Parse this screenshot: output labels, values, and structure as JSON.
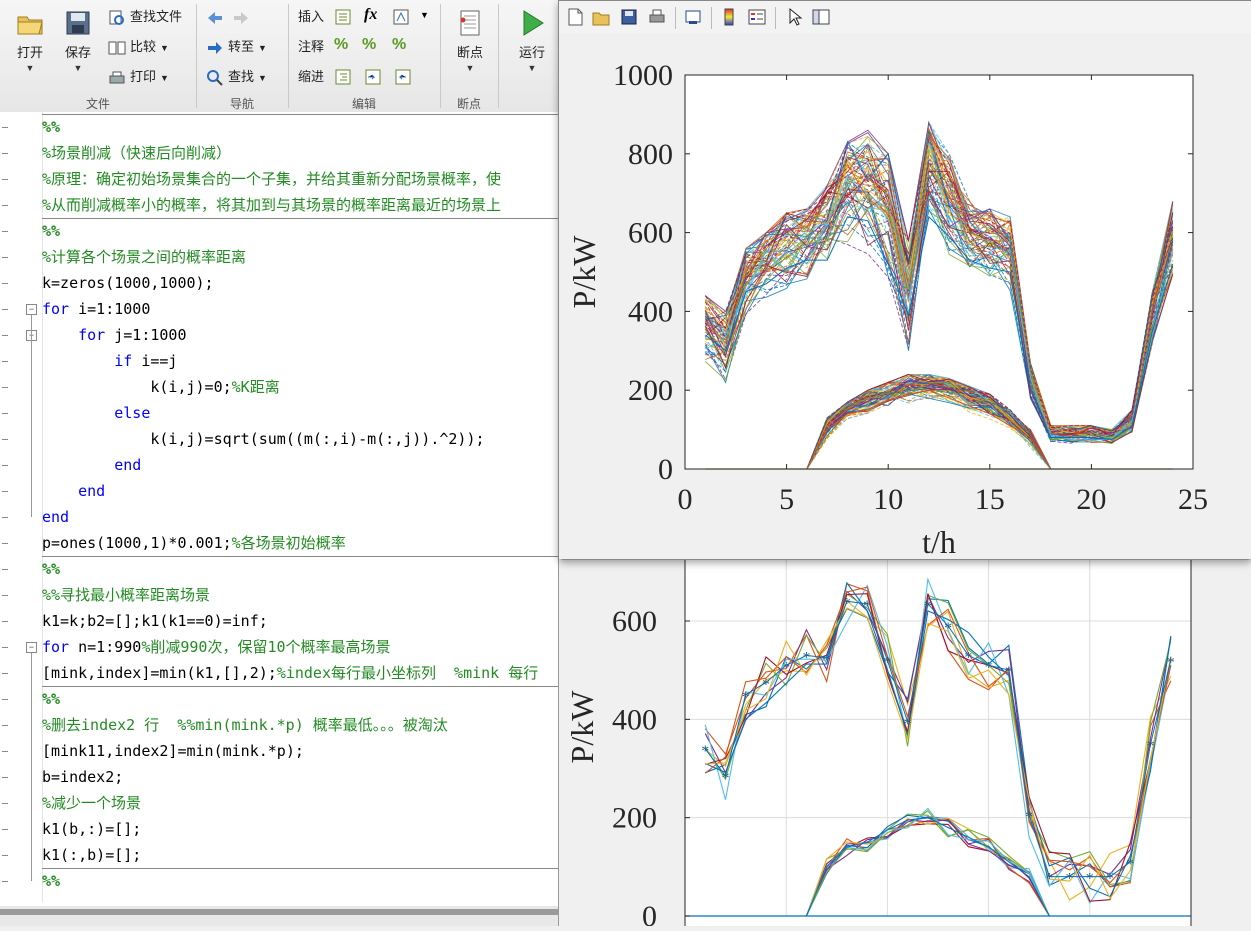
{
  "toolstrip": {
    "file": {
      "open": "打开",
      "save": "保存",
      "find_files": "查找文件",
      "compare": "比较",
      "print": "打印",
      "section": "文件"
    },
    "navigate": {
      "goto": "转至",
      "find": "查找",
      "section": "导航"
    },
    "edit": {
      "insert": "插入",
      "comment": "注释",
      "indent": "缩进",
      "fx": "fx",
      "section": "编辑"
    },
    "breakpoints": {
      "label": "断点",
      "section": "断点"
    },
    "run": {
      "label": "运行"
    }
  },
  "code_lines": [
    {
      "type": "cell",
      "text": "%%"
    },
    {
      "type": "comment",
      "text": "%场景削减（快速后向削减）"
    },
    {
      "type": "comment",
      "text": "%原理：确定初始场景集合的一个子集，并给其重新分配场景概率，使"
    },
    {
      "type": "comment",
      "text": "%从而削减概率小的概率，将其加到与其场景的概率距离最近的场景上"
    },
    {
      "type": "cell",
      "text": "%%"
    },
    {
      "type": "comment",
      "text": "%计算各个场景之间的概率距离"
    },
    {
      "type": "code",
      "text": "k=zeros(1000,1000);"
    },
    {
      "type": "kw",
      "kw": "for",
      "rest": " i=1:1000",
      "indent": ""
    },
    {
      "type": "kw",
      "kw": "for",
      "rest": " j=1:1000",
      "indent": "    "
    },
    {
      "type": "kw",
      "kw": "if",
      "rest": " i==j",
      "indent": "        "
    },
    {
      "type": "codecm",
      "code": "            k(i,j)=0;",
      "cm": "%K距离"
    },
    {
      "type": "kw",
      "kw": "else",
      "rest": "",
      "indent": "        "
    },
    {
      "type": "code",
      "text": "            k(i,j)=sqrt(sum((m(:,i)-m(:,j)).^2));"
    },
    {
      "type": "kw",
      "kw": "end",
      "rest": "",
      "indent": "        "
    },
    {
      "type": "kw",
      "kw": "end",
      "rest": "",
      "indent": "    "
    },
    {
      "type": "kw",
      "kw": "end",
      "rest": "",
      "indent": ""
    },
    {
      "type": "codecm",
      "code": "p=ones(1000,1)*0.001;",
      "cm": "%各场景初始概率"
    },
    {
      "type": "cell",
      "text": "%%"
    },
    {
      "type": "comment",
      "text": "%%寻找最小概率距离场景"
    },
    {
      "type": "code",
      "text": "k1=k;b2=[];k1(k1==0)=inf;"
    },
    {
      "type": "kwcm",
      "kw": "for",
      "rest": " n=1:990",
      "cm": "%削减990次，保留10个概率最高场景"
    },
    {
      "type": "codecm",
      "code": "[mink,index]=min(k1,[],2);",
      "cm": "%index每行最小坐标列  %mink 每行"
    },
    {
      "type": "cell",
      "text": "%%"
    },
    {
      "type": "codecm",
      "code": "",
      "cm": "%删去index2 行  %%min(mink.*p) 概率最低。。。被淘汰"
    },
    {
      "type": "code",
      "text": "[mink11,index2]=min(mink.*p);"
    },
    {
      "type": "code",
      "text": "b=index2;"
    },
    {
      "type": "comment",
      "text": "%减少一个场景"
    },
    {
      "type": "code",
      "text": "k1(b,:)=[];"
    },
    {
      "type": "code",
      "text": "k1(:,b)=[];"
    },
    {
      "type": "cell",
      "text": "%%"
    }
  ],
  "figure_top": {
    "chart_data": {
      "type": "line",
      "xlabel": "t/h",
      "ylabel": "P/kW",
      "xlim": [
        0,
        25
      ],
      "ylim": [
        0,
        1000
      ],
      "xticks": [
        "0",
        "5",
        "10",
        "15",
        "20",
        "25"
      ],
      "yticks": [
        "0",
        "200",
        "400",
        "600",
        "800",
        "1000"
      ],
      "x": [
        1,
        2,
        3,
        4,
        5,
        6,
        7,
        8,
        9,
        10,
        11,
        12,
        13,
        14,
        15,
        16,
        17,
        18,
        19,
        20,
        21,
        22,
        23,
        24
      ],
      "series": [
        {
          "values": [
            340,
            300,
            450,
            470,
            510,
            530,
            530,
            640,
            630,
            520,
            390,
            640,
            590,
            530,
            510,
            500,
            200,
            80,
            80,
            80,
            75,
            110,
            350,
            520
          ]
        },
        {
          "values": [
            0,
            0,
            0,
            0,
            0,
            0,
            100,
            140,
            150,
            175,
            190,
            200,
            180,
            160,
            140,
            110,
            80,
            0,
            0,
            0,
            0,
            0,
            0,
            0
          ]
        }
      ],
      "envelopes": [
        {
          "name": "upper_band",
          "min": [
            250,
            200,
            380,
            420,
            430,
            460,
            470,
            550,
            520,
            450,
            270,
            580,
            520,
            470,
            440,
            440,
            170,
            60,
            60,
            60,
            60,
            80,
            300,
            450
          ],
          "max": [
            440,
            400,
            560,
            600,
            650,
            660,
            720,
            830,
            860,
            800,
            580,
            880,
            800,
            680,
            660,
            640,
            270,
            110,
            110,
            110,
            100,
            150,
            450,
            680
          ]
        },
        {
          "name": "lower_band",
          "min": [
            0,
            0,
            0,
            0,
            0,
            0,
            70,
            120,
            130,
            150,
            160,
            170,
            160,
            140,
            120,
            90,
            50,
            0,
            0,
            0,
            0,
            0,
            0,
            0
          ],
          "max": [
            0,
            0,
            0,
            0,
            0,
            0,
            130,
            170,
            200,
            220,
            240,
            240,
            230,
            210,
            190,
            150,
            100,
            0,
            0,
            0,
            0,
            0,
            0,
            0
          ]
        }
      ],
      "grid": false
    }
  },
  "figure_bottom": {
    "chart_data": {
      "type": "line",
      "ylabel": "P/kW",
      "yticks": [
        "0",
        "200",
        "400",
        "600"
      ],
      "ylim": [
        0,
        720
      ],
      "x": [
        1,
        2,
        3,
        4,
        5,
        6,
        7,
        8,
        9,
        10,
        11,
        12,
        13,
        14,
        15,
        16,
        17,
        18,
        19,
        20,
        21,
        22,
        23,
        24
      ],
      "series": [
        {
          "values": [
            340,
            285,
            450,
            475,
            510,
            530,
            525,
            640,
            635,
            520,
            395,
            635,
            590,
            530,
            510,
            500,
            205,
            80,
            80,
            80,
            80,
            110,
            350,
            520
          ]
        },
        {
          "values": [
            0,
            0,
            0,
            0,
            0,
            0,
            100,
            140,
            150,
            175,
            195,
            200,
            180,
            160,
            140,
            110,
            80,
            0,
            0,
            0,
            0,
            0,
            0,
            0
          ]
        }
      ],
      "grid": true
    }
  },
  "colors": {
    "matlab_palette": [
      "#0072BD",
      "#D95319",
      "#EDB120",
      "#7E2F8E",
      "#77AC30",
      "#4DBEEE",
      "#A2142F"
    ],
    "comment": "#228B22",
    "keyword": "#0000ff"
  }
}
